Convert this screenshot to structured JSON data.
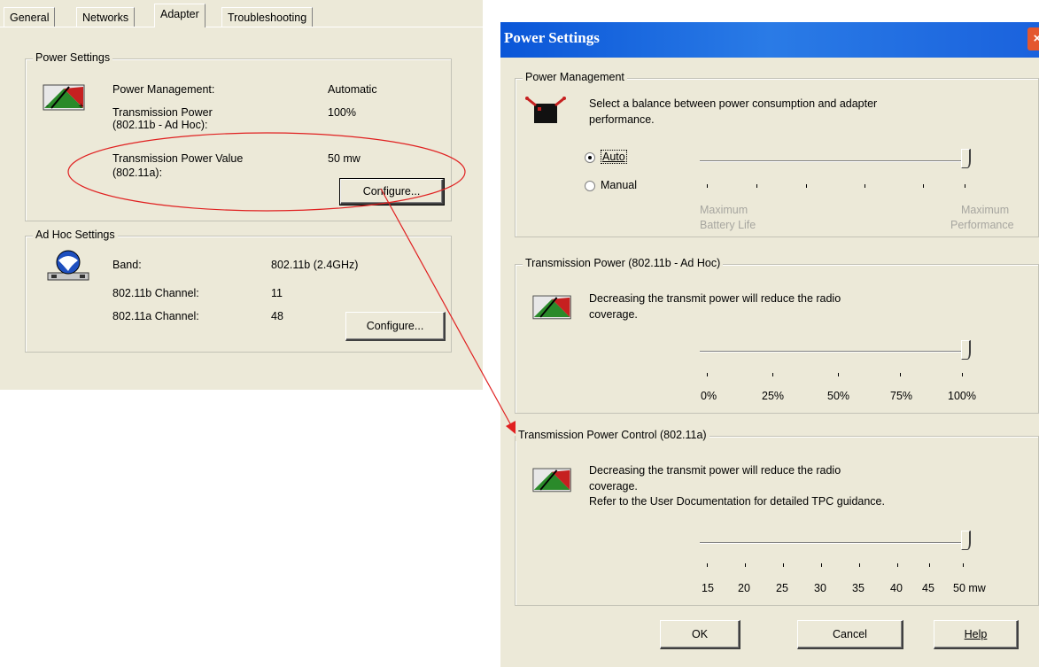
{
  "tabs": [
    "General",
    "Networks",
    "Adapter",
    "Troubleshooting"
  ],
  "power_settings": {
    "title": "Power Settings",
    "power_management_label": "Power Management:",
    "power_management_value": "Automatic",
    "transmission_power_label_1": "Transmission Power",
    "transmission_power_label_2": "(802.11b - Ad Hoc):",
    "transmission_power_value": "100%",
    "tx_power_value_label_1": "Transmission Power Value",
    "tx_power_value_label_2": "(802.11a):",
    "tx_power_value": "50 mw",
    "configure_label": "Configure..."
  },
  "adhoc_settings": {
    "title": "Ad Hoc Settings",
    "band_label": "Band:",
    "band_value": "802.11b (2.4GHz)",
    "channel_b_label": "802.11b Channel:",
    "channel_b_value": "11",
    "channel_a_label": "802.11a Channel:",
    "channel_a_value": "48",
    "configure_label": "Configure..."
  },
  "dialog": {
    "title": "Power Settings",
    "close_glyph": "×",
    "power_management": {
      "title": "Power Management",
      "description_1": "Select a balance between power consumption and adapter",
      "description_2": "performance.",
      "auto_label": "Auto",
      "manual_label": "Manual",
      "selected": "Auto",
      "slider_level": 1.0,
      "min_label_1": "Maximum",
      "min_label_2": "Battery Life",
      "max_label_1": "Maximum",
      "max_label_2": "Performance"
    },
    "tx_power_adhoc": {
      "title": "Transmission Power (802.11b - Ad Hoc)",
      "description_1": "Decreasing the transmit power will reduce the radio",
      "description_2": "coverage.",
      "ticks": [
        "0%",
        "25%",
        "50%",
        "75%",
        "100%"
      ],
      "value": "100%"
    },
    "tx_power_control": {
      "title": "Transmission Power Control (802.11a)",
      "description_1": "Decreasing the transmit power will reduce the radio",
      "description_2": "coverage.",
      "description_3": "Refer to the User Documentation for detailed TPC guidance.",
      "ticks": [
        "15",
        "20",
        "25",
        "30",
        "35",
        "40",
        "45",
        "50 mw"
      ],
      "value": "50 mw"
    },
    "buttons": {
      "ok": "OK",
      "cancel": "Cancel",
      "help": "Help"
    }
  },
  "colors": {
    "annotation_red": "#e02020",
    "window_bg": "#ece9d8",
    "titlebar_blue": "#0a56d8"
  }
}
